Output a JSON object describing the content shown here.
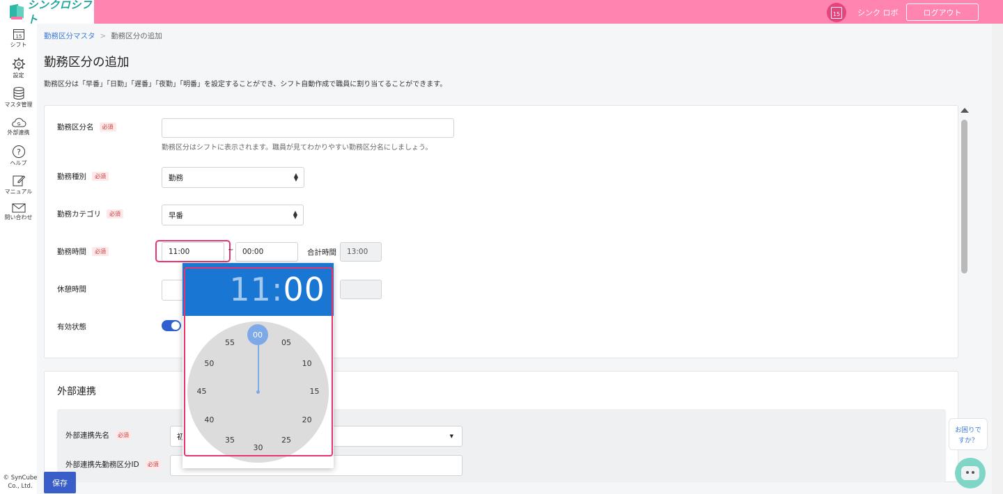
{
  "header": {
    "logo_text": "シンクロシフト",
    "calendar_day": "15",
    "user_name": "シンク ロボ",
    "logout_label": "ログアウト"
  },
  "sidebar": {
    "items": [
      {
        "label": "シフト",
        "icon": "calendar-icon"
      },
      {
        "label": "設定",
        "icon": "gear-icon"
      },
      {
        "label": "マスタ管理",
        "icon": "database-icon"
      },
      {
        "label": "外部連携",
        "icon": "cloud-sync-icon"
      },
      {
        "label": "ヘルプ",
        "icon": "help-icon"
      },
      {
        "label": "マニュアル",
        "icon": "edit-icon"
      },
      {
        "label": "問い合わせ",
        "icon": "mail-icon"
      }
    ],
    "copyright": "© SynCube Co., Ltd."
  },
  "breadcrumb": {
    "parent": "勤務区分マスタ",
    "separator": ">",
    "current": "勤務区分の追加"
  },
  "page": {
    "title": "勤務区分の追加",
    "description": "勤務区分は「早番」「日勤」「遅番」「夜勤」「明番」を設定することができ、シフト自動作成で職員に割り当てることができます。"
  },
  "form": {
    "required_badge": "必須",
    "name": {
      "label": "勤務区分名",
      "value": "",
      "hint": "勤務区分はシフトに表示されます。職員が見てわかりやすい勤務区分名にしましょう。"
    },
    "type": {
      "label": "勤務種別",
      "value": "勤務"
    },
    "category": {
      "label": "勤務カテゴリ",
      "value": "早番"
    },
    "time": {
      "label": "勤務時間",
      "start": "11:00",
      "end": "00:00",
      "range_sep": "~",
      "total_label": "合計時間",
      "total_value": "13:00"
    },
    "break": {
      "label": "休憩時間",
      "value": ""
    },
    "active": {
      "label": "有効状態",
      "on": true
    }
  },
  "external": {
    "title": "外部連携",
    "dest_label": "外部連携先名",
    "dest_value": "初",
    "id_label": "外部連携先勤務区分ID",
    "id_value": ""
  },
  "picker": {
    "hour": "11",
    "colon": ":",
    "minute": "00",
    "ticks": [
      "00",
      "05",
      "10",
      "15",
      "20",
      "25",
      "30",
      "35",
      "40",
      "45",
      "50",
      "55"
    ],
    "selected": "00"
  },
  "save_label": "保存",
  "help": {
    "line1": "お困りで",
    "line2": "すか？"
  },
  "colors": {
    "header": "#ff85b0",
    "accent": "#1976d2",
    "highlight": "#e8336b",
    "primary_button": "#3a5ec9"
  }
}
